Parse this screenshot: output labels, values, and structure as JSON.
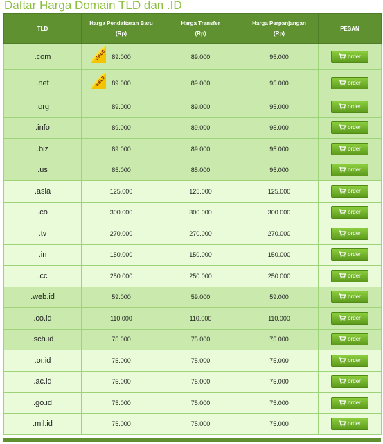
{
  "page": {
    "title": "Daftar Harga Domain TLD dan .ID"
  },
  "table": {
    "headers": {
      "tld": "TLD",
      "new_reg": "Harga Pendaftaran Baru\n(Rp)",
      "transfer": "Harga Transfer\n(Rp)",
      "renewal": "Harga Perpanjangan\n(Rp)",
      "order": "PESAN"
    },
    "sale_label": "SALE",
    "order_label": "order",
    "rows": [
      {
        "tld": ".com",
        "new": "89.000",
        "transfer": "89.000",
        "renew": "95.000"
      },
      {
        "tld": ".net",
        "new": "89.000",
        "transfer": "89.000",
        "renew": "95.000"
      },
      {
        "tld": ".org",
        "new": "89.000",
        "transfer": "89.000",
        "renew": "95.000"
      },
      {
        "tld": ".info",
        "new": "89.000",
        "transfer": "89.000",
        "renew": "95.000"
      },
      {
        "tld": ".biz",
        "new": "89.000",
        "transfer": "89.000",
        "renew": "95.000"
      },
      {
        "tld": ".us",
        "new": "85.000",
        "transfer": "85.000",
        "renew": "95.000"
      },
      {
        "tld": ".asia",
        "new": "125.000",
        "transfer": "125.000",
        "renew": "125.000"
      },
      {
        "tld": ".co",
        "new": "300.000",
        "transfer": "300.000",
        "renew": "300.000"
      },
      {
        "tld": ".tv",
        "new": "270.000",
        "transfer": "270.000",
        "renew": "270.000"
      },
      {
        "tld": ".in",
        "new": "150.000",
        "transfer": "150.000",
        "renew": "150.000"
      },
      {
        "tld": ".cc",
        "new": "250.000",
        "transfer": "250.000",
        "renew": "250.000"
      },
      {
        "tld": ".web.id",
        "new": "59.000",
        "transfer": "59.000",
        "renew": "59.000"
      },
      {
        "tld": ".co.id",
        "new": "110.000",
        "transfer": "110.000",
        "renew": "110.000"
      },
      {
        "tld": ".sch.id",
        "new": "75.000",
        "transfer": "75.000",
        "renew": "75.000"
      },
      {
        "tld": ".or.id",
        "new": "75.000",
        "transfer": "75.000",
        "renew": "75.000"
      },
      {
        "tld": ".ac.id",
        "new": "75.000",
        "transfer": "75.000",
        "renew": "75.000"
      },
      {
        "tld": ".go.id",
        "new": "75.000",
        "transfer": "75.000",
        "renew": "75.000"
      },
      {
        "tld": ".mil.id",
        "new": "75.000",
        "transfer": "75.000",
        "renew": "75.000"
      }
    ]
  },
  "colors": {
    "title": "#8cbf3f",
    "header_bg": "#5f9131",
    "row_dark": "#c9e9ad",
    "row_light": "#e9fbd8",
    "button": "#6fb02a",
    "sale_badge": "#f5c400"
  }
}
